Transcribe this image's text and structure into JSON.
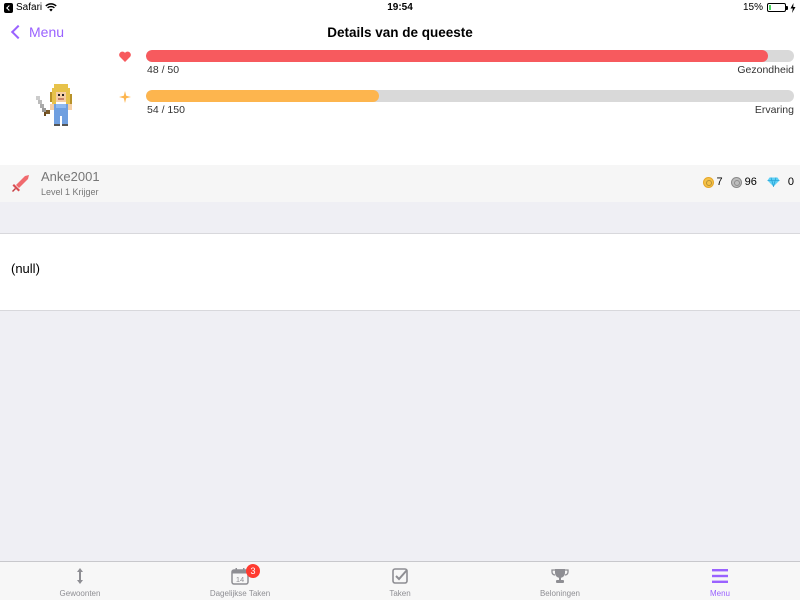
{
  "status_bar": {
    "app": "Safari",
    "time": "19:54",
    "battery": "15%",
    "battery_level": 0.15
  },
  "nav": {
    "back_label": "Menu",
    "title": "Details van de queeste"
  },
  "stats": {
    "health": {
      "value": "48 / 50",
      "label": "Gezondheid",
      "fraction": 0.96,
      "color": "#f75a5e",
      "icon": "heart-icon"
    },
    "experience": {
      "value": "54 / 150",
      "label": "Ervaring",
      "fraction": 0.36,
      "color": "#fdb54e",
      "icon": "star-icon"
    }
  },
  "user": {
    "name": "Anke2001",
    "level": "Level 1 Krijger",
    "class_icon": "sword-icon",
    "gold": "7",
    "silver": "96",
    "gems": "0"
  },
  "content": {
    "text": "(null)"
  },
  "tabs": [
    {
      "label": "Gewoonten",
      "icon": "habits-icon"
    },
    {
      "label": "Dagelijkse Taken",
      "icon": "calendar-icon",
      "badge": "3",
      "date": "14"
    },
    {
      "label": "Taken",
      "icon": "checkbox-icon"
    },
    {
      "label": "Beloningen",
      "icon": "trophy-icon"
    },
    {
      "label": "Menu",
      "icon": "menu-icon",
      "active": true
    }
  ],
  "colors": {
    "accent": "#9a62ff",
    "health": "#f75a5e",
    "experience": "#fdb54e"
  }
}
